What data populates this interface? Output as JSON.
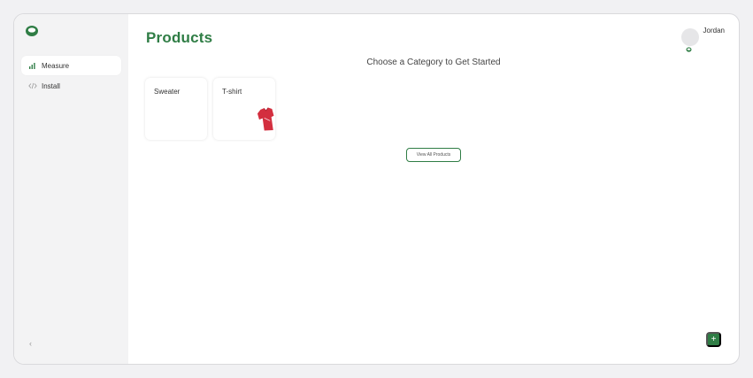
{
  "brand": {
    "logo_icon": "brand-logo-icon",
    "accent_color": "#2f7d45"
  },
  "sidebar": {
    "items": [
      {
        "label": "Measure",
        "icon": "bar-chart-icon",
        "active": true
      },
      {
        "label": "Install",
        "icon": "code-icon",
        "active": false
      }
    ],
    "collapse_glyph": "‹"
  },
  "header": {
    "title": "Products",
    "user": {
      "name": "Jordan",
      "avatar_icon": "user-avatar"
    }
  },
  "main": {
    "subtitle": "Choose a Category to Get Started",
    "categories": [
      {
        "label": "Sweater"
      },
      {
        "label": "T-shirt",
        "image": "red-tshirt-image"
      }
    ],
    "view_all_label": "View All Products",
    "add_label": "+"
  }
}
